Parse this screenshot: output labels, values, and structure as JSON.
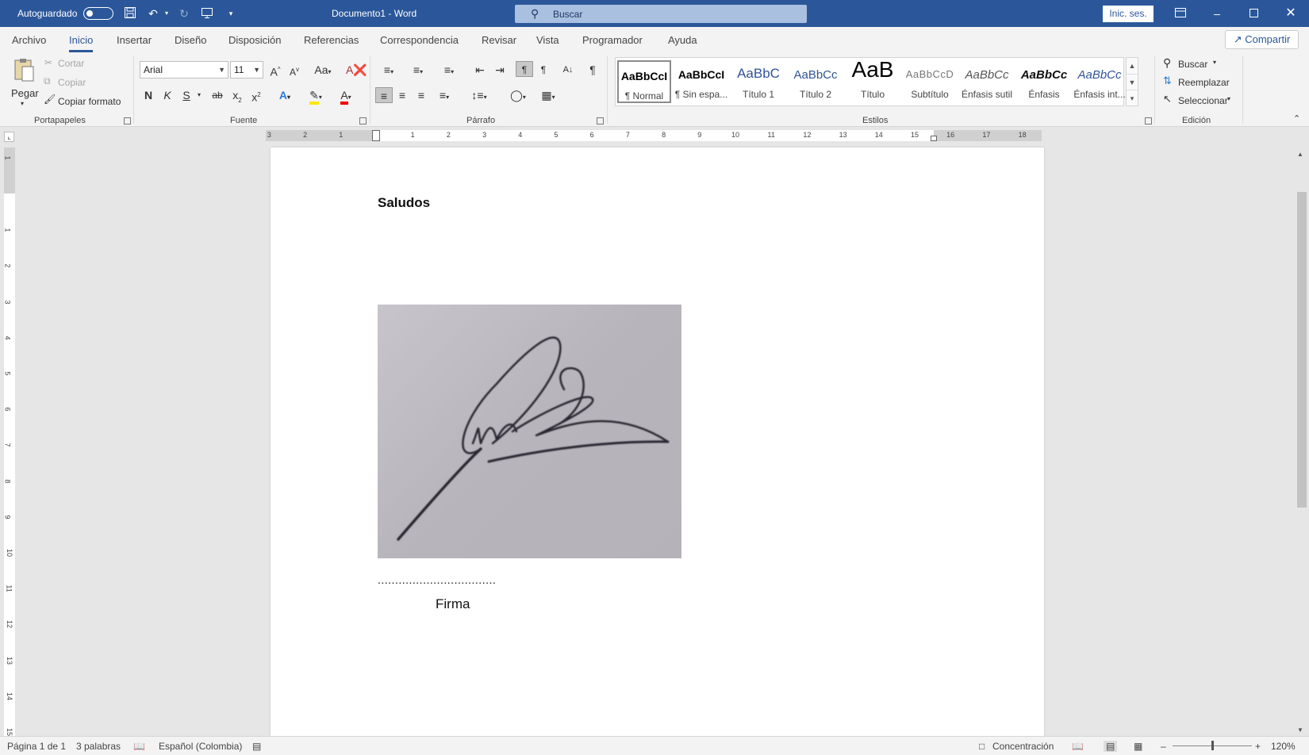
{
  "titlebar": {
    "autosave_label": "Autoguardado",
    "doc_title": "Documento1 - Word",
    "search_label": "Buscar",
    "signin_label": "Inic. ses."
  },
  "tabs": [
    "Archivo",
    "Inicio",
    "Insertar",
    "Diseño",
    "Disposición",
    "Referencias",
    "Correspondencia",
    "Revisar",
    "Vista",
    "Programador",
    "Ayuda"
  ],
  "share_label": "Compartir",
  "clipboard": {
    "paste": "Pegar",
    "cut": "Cortar",
    "copy": "Copiar",
    "format_painter": "Copiar formato",
    "group": "Portapapeles"
  },
  "font": {
    "name": "Arial",
    "size": "11",
    "group": "Fuente",
    "case_label": "Aa",
    "bold": "N",
    "italic": "K",
    "underline": "S"
  },
  "paragraph": {
    "group": "Párrafo"
  },
  "styles": {
    "group": "Estilos",
    "items": [
      {
        "preview": "AaBbCcI",
        "name": "¶ Normal"
      },
      {
        "preview": "AaBbCcI",
        "name": "¶ Sin espa..."
      },
      {
        "preview": "AaBbC",
        "name": "Título 1"
      },
      {
        "preview": "AaBbCc",
        "name": "Título 2"
      },
      {
        "preview": "AaB",
        "name": "Título"
      },
      {
        "preview": "AaBbCcD",
        "name": "Subtítulo"
      },
      {
        "preview": "AaBbCc",
        "name": "Énfasis sutil"
      },
      {
        "preview": "AaBbCc",
        "name": "Énfasis"
      },
      {
        "preview": "AaBbCc",
        "name": "Énfasis int..."
      }
    ]
  },
  "editing": {
    "find": "Buscar",
    "replace": "Reemplazar",
    "select": "Seleccionar",
    "group": "Edición"
  },
  "ruler": {
    "h_numbers": [
      "3",
      "2",
      "1",
      "1",
      "2",
      "3",
      "4",
      "5",
      "6",
      "7",
      "8",
      "9",
      "10",
      "11",
      "12",
      "13",
      "14",
      "15",
      "16",
      "17",
      "18"
    ],
    "v_numbers": [
      "1",
      "1",
      "2",
      "3",
      "4",
      "5",
      "6",
      "7",
      "8",
      "9",
      "10",
      "11",
      "12",
      "13",
      "14",
      "15"
    ]
  },
  "document": {
    "greeting": "Saludos",
    "signature_line": "..................................",
    "signature_label": "Firma"
  },
  "status": {
    "page": "Página 1 de 1",
    "words": "3 palabras",
    "language": "Español (Colombia)",
    "focus": "Concentración",
    "zoom": "120%"
  },
  "colors": {
    "titlebar": "#2b579a",
    "accent": "#2b579a",
    "highlight": "#ffff00",
    "font_color": "#ff0000"
  }
}
